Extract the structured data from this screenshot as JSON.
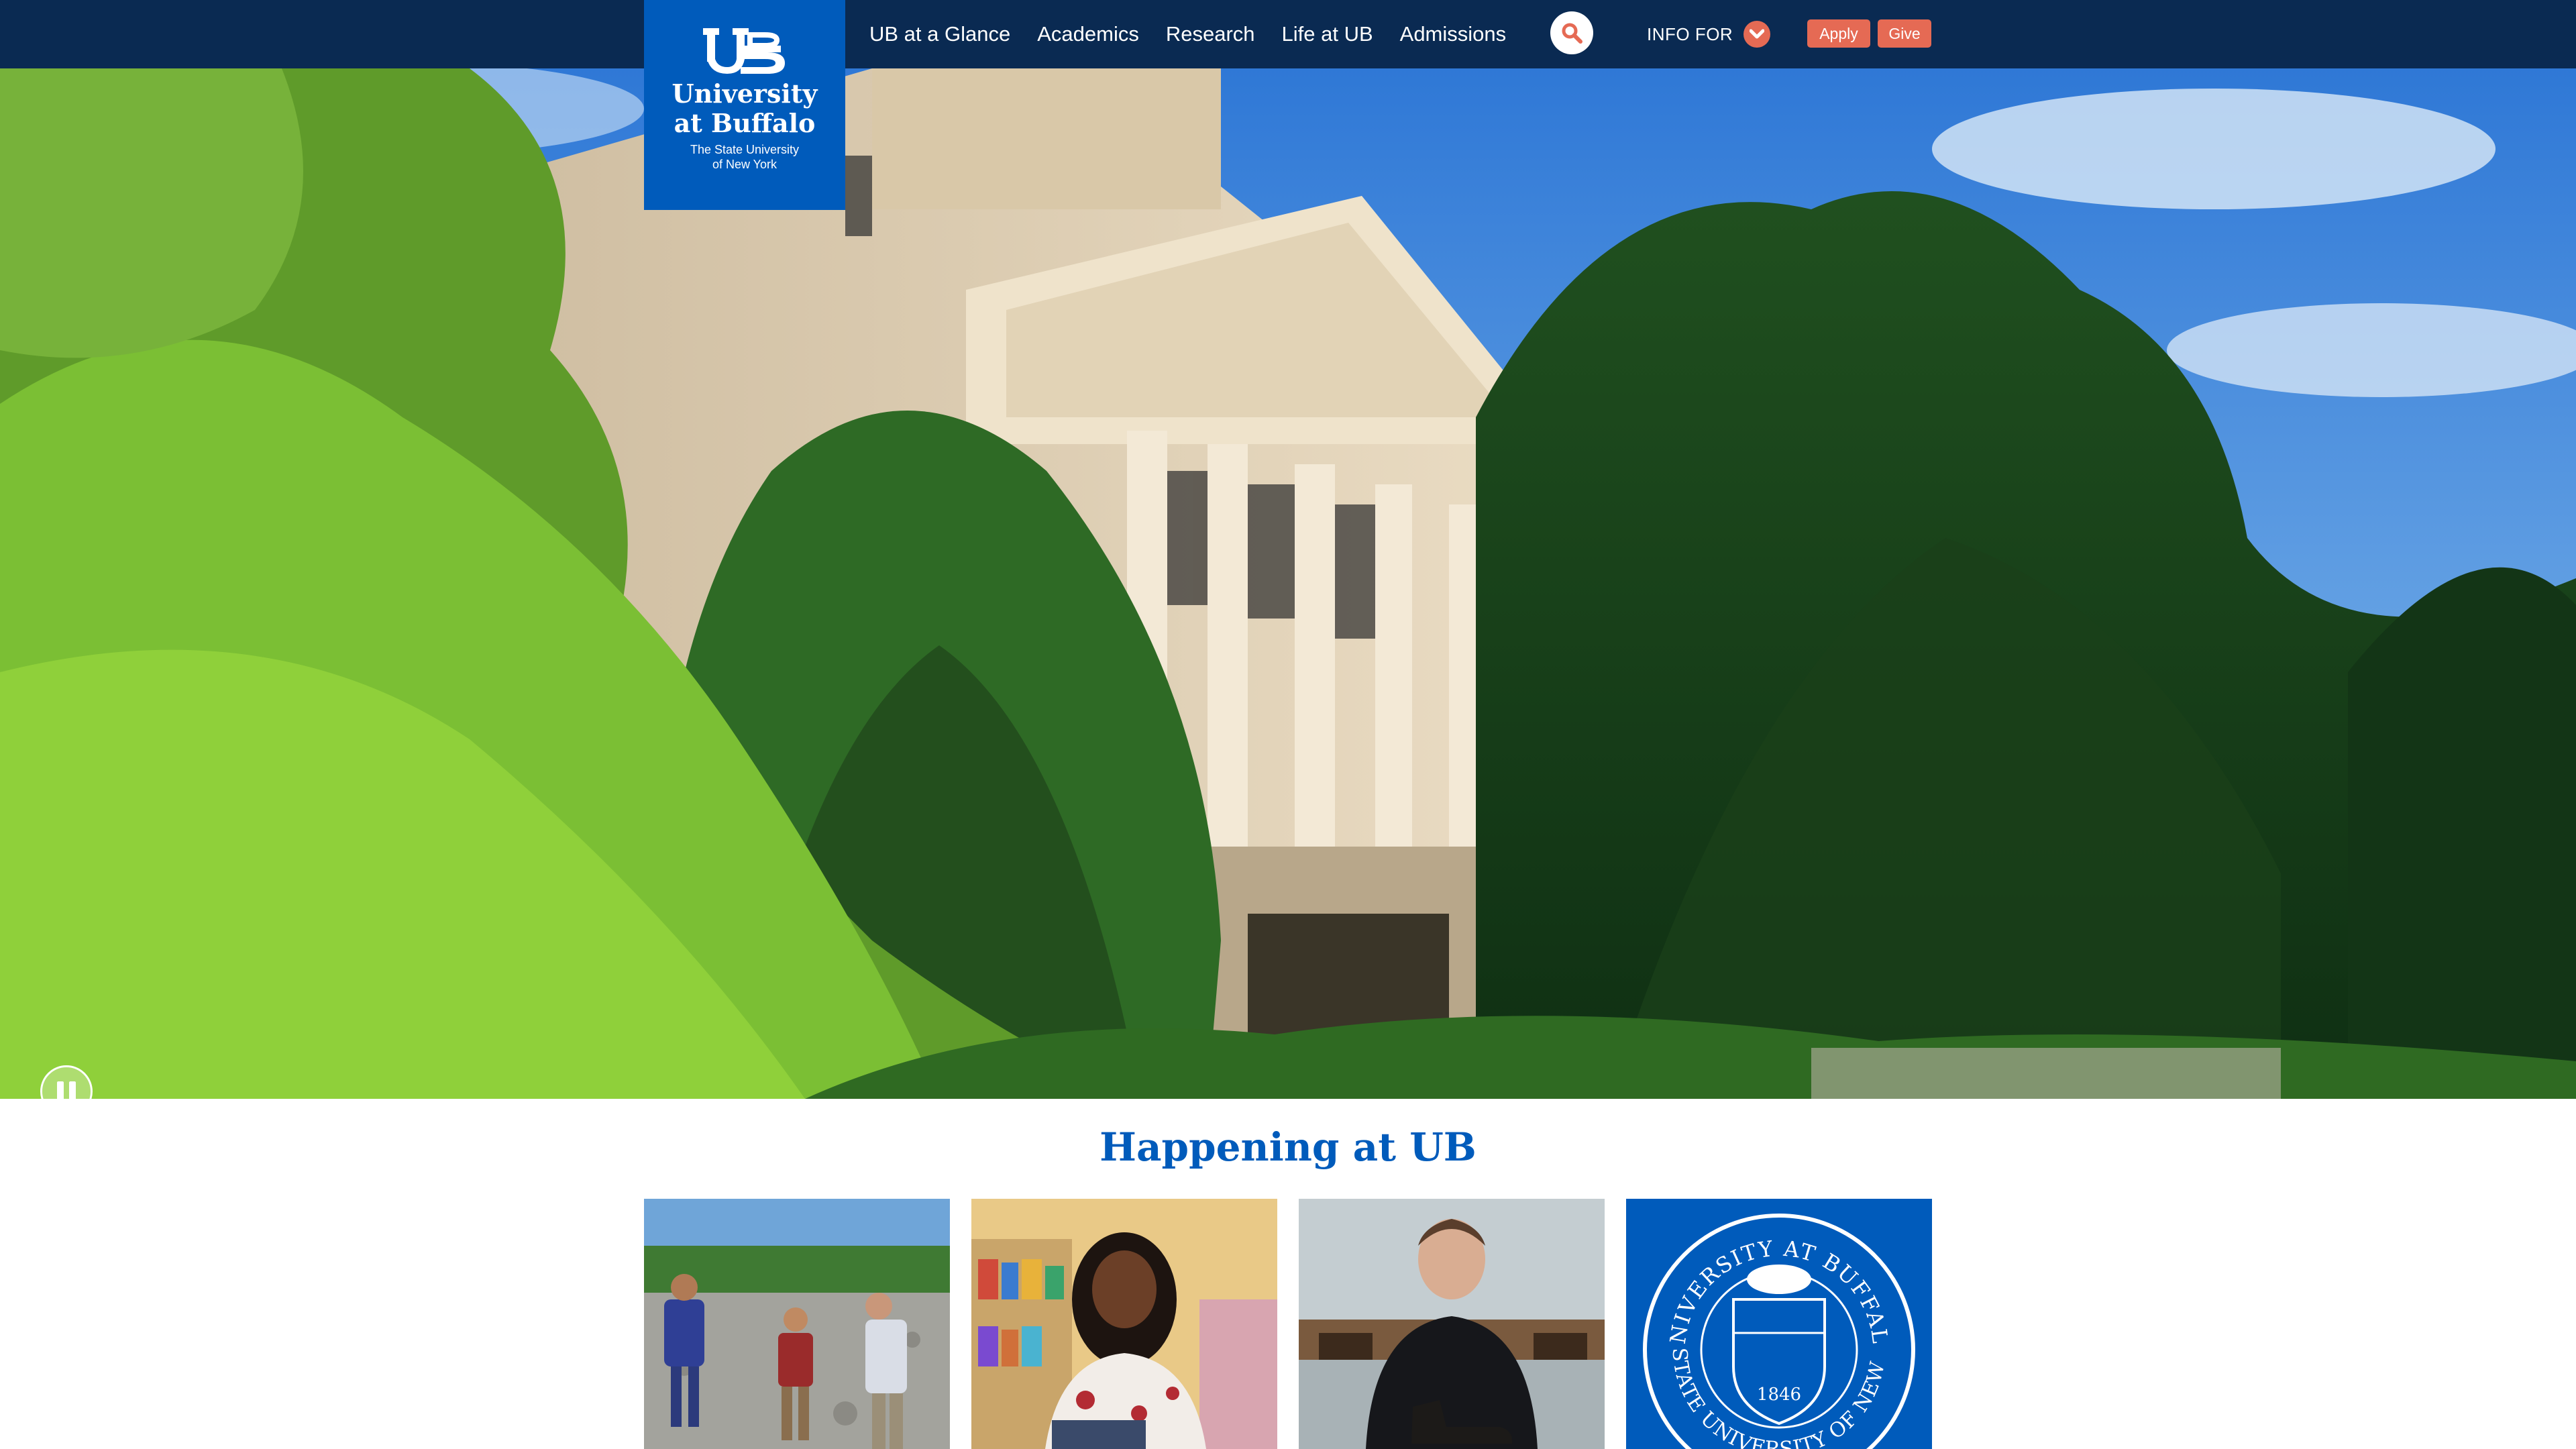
{
  "header": {
    "logo": {
      "name_line1": "University",
      "name_line2": "at Buffalo",
      "tagline_line1": "The State University",
      "tagline_line2": "of New York"
    },
    "nav": [
      {
        "label": "UB at a Glance"
      },
      {
        "label": "Academics"
      },
      {
        "label": "Research"
      },
      {
        "label": "Life at UB"
      },
      {
        "label": "Admissions"
      }
    ],
    "search_icon": "search-icon",
    "info_for": {
      "label": "INFO FOR",
      "icon": "chevron-down-icon"
    },
    "apply_label": "Apply",
    "give_label": "Give"
  },
  "hero": {
    "control_icon": "pause-icon"
  },
  "happening": {
    "title": "Happening at UB",
    "cards": [
      {
        "image": "researchers examining rocks in a quarry"
      },
      {
        "image": "student seated in front of a bookshelf"
      },
      {
        "image": "man holding a boot in a workshop"
      },
      {
        "image": "University at Buffalo seal"
      }
    ]
  },
  "seal": {
    "top_text": "UNIVERSITY AT BUFFALO",
    "bottom_text": "THE STATE UNIVERSITY OF NEW YORK",
    "year": "1846"
  },
  "colors": {
    "nav_bg": "#0a2a52",
    "ub_blue": "#005bbb",
    "accent": "#e56a54"
  }
}
